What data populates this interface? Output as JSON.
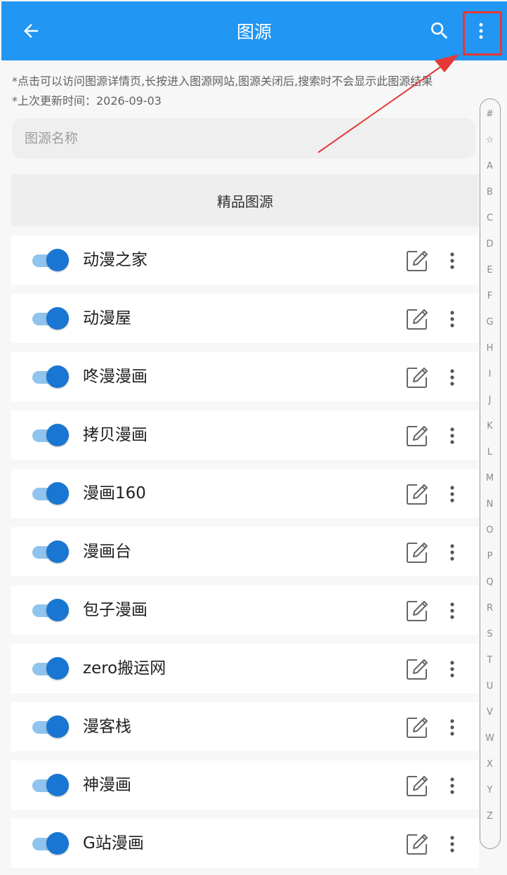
{
  "appbar": {
    "title": "图源",
    "back_icon": "arrow-back-icon",
    "search_icon": "search-icon",
    "more_icon": "more-vert-icon",
    "color": "#2196f3"
  },
  "notes": {
    "line1": "*点击可以访问图源详情页,长按进入图源网站,图源关闭后,搜索时不会显示此图源结果",
    "line2": "*上次更新时间：2026-09-03"
  },
  "search": {
    "placeholder": "图源名称"
  },
  "section": {
    "title": "精品图源"
  },
  "sources": [
    {
      "name": "动漫之家",
      "enabled": true
    },
    {
      "name": "动漫屋",
      "enabled": true
    },
    {
      "name": "咚漫漫画",
      "enabled": true
    },
    {
      "name": "拷贝漫画",
      "enabled": true
    },
    {
      "name": "漫画160",
      "enabled": true
    },
    {
      "name": "漫画台",
      "enabled": true
    },
    {
      "name": "包子漫画",
      "enabled": true
    },
    {
      "name": "zero搬运网",
      "enabled": true
    },
    {
      "name": "漫客栈",
      "enabled": true
    },
    {
      "name": "神漫画",
      "enabled": true
    },
    {
      "name": "G站漫画",
      "enabled": true
    }
  ],
  "alphabet_index": [
    "#",
    "☆",
    "A",
    "B",
    "C",
    "D",
    "E",
    "F",
    "G",
    "H",
    "I",
    "J",
    "K",
    "L",
    "M",
    "N",
    "O",
    "P",
    "Q",
    "R",
    "S",
    "T",
    "U",
    "V",
    "W",
    "X",
    "Y",
    "Z"
  ],
  "annotation": {
    "color": "#e53935"
  }
}
